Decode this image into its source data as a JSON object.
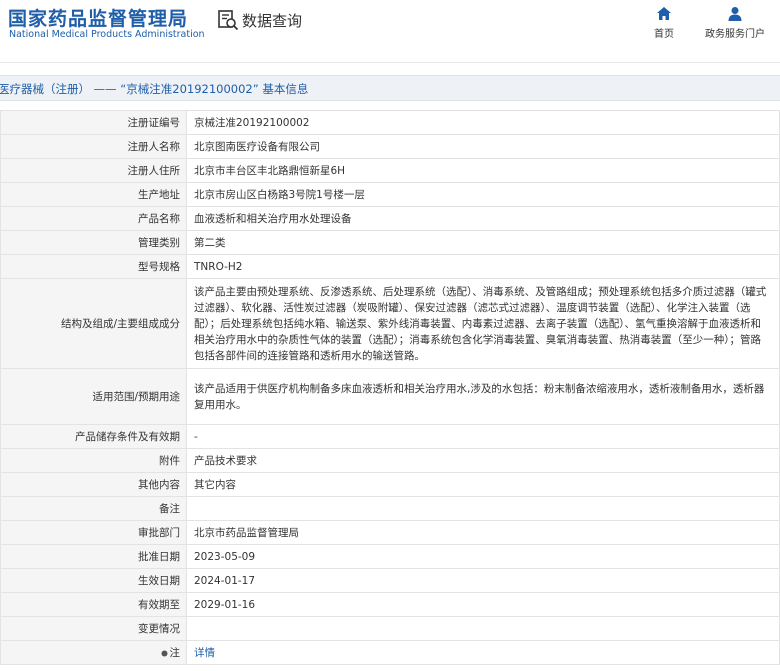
{
  "header": {
    "logo_cn": "国家药品监督管理局",
    "logo_en": "National Medical Products Administration",
    "query_label": "数据查询",
    "nav": [
      {
        "label": "首页",
        "icon": "home-icon"
      },
      {
        "label": "政务服务门户",
        "icon": "user-icon"
      }
    ]
  },
  "breadcrumb": "医疗器械（注册） —— “京械注准20192100002” 基本信息",
  "colors": {
    "brand": "#1f5ea8",
    "label_bg": "#f5f5f5",
    "title_bg": "#eef1f5",
    "border": "#e3e3e3"
  },
  "rows": [
    {
      "label": "注册证编号",
      "value": "京械注准20192100002"
    },
    {
      "label": "注册人名称",
      "value": "北京图南医疗设备有限公司"
    },
    {
      "label": "注册人住所",
      "value": "北京市丰台区丰北路鼎恒新星6H"
    },
    {
      "label": "生产地址",
      "value": "北京市房山区白杨路3号院1号楼一层"
    },
    {
      "label": "产品名称",
      "value": "血液透析和相关治疗用水处理设备"
    },
    {
      "label": "管理类别",
      "value": "第二类"
    },
    {
      "label": "型号规格",
      "value": "TNRO-H2"
    },
    {
      "label": "结构及组成/主要组成成分",
      "value": "该产品主要由预处理系统、反渗透系统、后处理系统（选配）、消毒系统、及管路组成；预处理系统包括多介质过滤器（罐式过滤器）、软化器、活性炭过滤器（炭吸附罐）、保安过滤器（滤芯式过滤器）、温度调节装置（选配）、化学注入装置（选配）；后处理系统包括纯水箱、输送泵、紫外线消毒装置、内毒素过滤器、去离子装置（选配）、氢气重换溶解于血液透析和相关治疗用水中的杂质性气体的装置（选配）；消毒系统包含化学消毒装置、臭氧消毒装置、热消毒装置（至少一种）；管路包括各部件间的连接管路和透析用水的输送管路。"
    },
    {
      "label": "适用范围/预期用途",
      "value": "该产品适用于供医疗机构制备多床血液透析和相关治疗用水,涉及的水包括：粉末制备浓缩液用水，透析液制备用水，透析器复用用水。"
    },
    {
      "label": "产品储存条件及有效期",
      "value": "-"
    },
    {
      "label": "附件",
      "value": "产品技术要求"
    },
    {
      "label": "其他内容",
      "value": "其它内容"
    },
    {
      "label": "备注",
      "value": ""
    },
    {
      "label": "审批部门",
      "value": "北京市药品监督管理局"
    },
    {
      "label": "批准日期",
      "value": "2023-05-09"
    },
    {
      "label": "生效日期",
      "value": "2024-01-17"
    },
    {
      "label": "有效期至",
      "value": "2029-01-16"
    },
    {
      "label": "变更情况",
      "value": ""
    }
  ],
  "note_row": {
    "label": "注",
    "icon": "bullet-icon",
    "link": "详情"
  }
}
